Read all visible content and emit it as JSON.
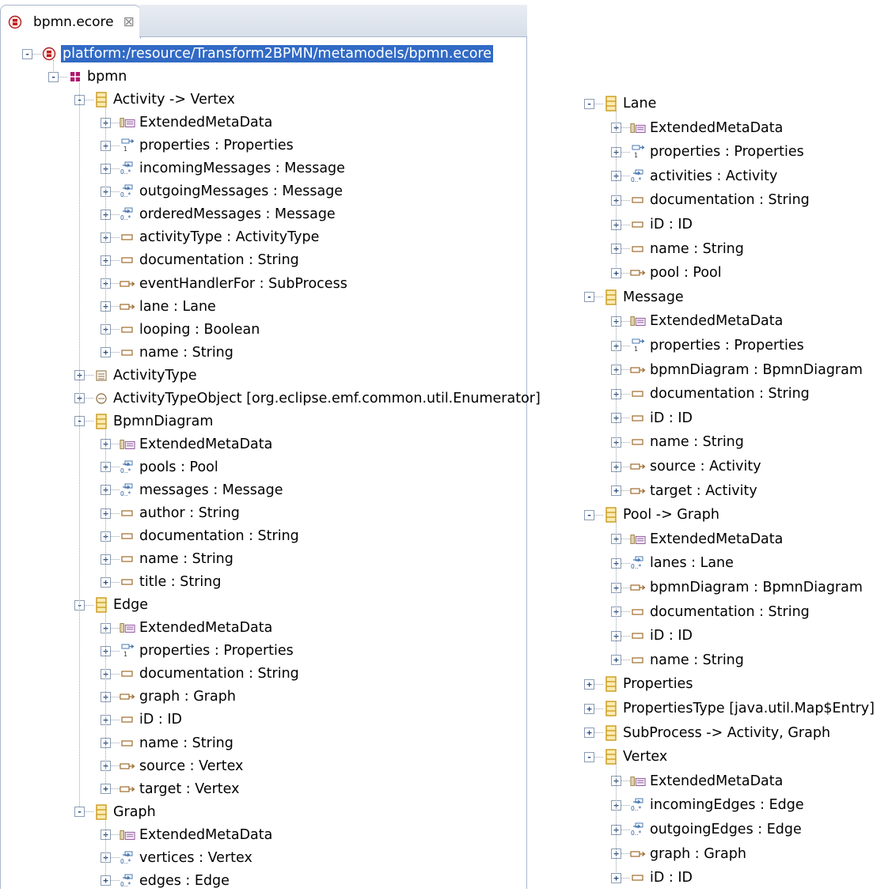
{
  "tab": {
    "title": "bpmn.ecore",
    "close_glyph": "⊠"
  },
  "colors": {
    "selection": "#316ac5",
    "class_icon": "#e8b840",
    "tree_lines": "#9aa4b0"
  },
  "left_tree": [
    {
      "label": "platform:/resource/Transform2BPMN/metamodels/bpmn.ecore",
      "icon": "resource-icon",
      "toggle": "-",
      "level": 0,
      "selected": true
    },
    {
      "label": "bpmn",
      "icon": "package-icon",
      "toggle": "-",
      "level": 1
    },
    {
      "label": "Activity -> Vertex",
      "icon": "eclass-icon",
      "toggle": "-",
      "level": 2
    },
    {
      "label": "ExtendedMetaData",
      "icon": "annotation-icon",
      "toggle": "+",
      "level": 3
    },
    {
      "label": "properties : Properties",
      "icon": "containment-one-icon",
      "toggle": "+",
      "level": 3
    },
    {
      "label": "incomingMessages : Message",
      "icon": "containment-many-icon",
      "toggle": "+",
      "level": 3
    },
    {
      "label": "outgoingMessages : Message",
      "icon": "containment-many-icon",
      "toggle": "+",
      "level": 3
    },
    {
      "label": "orderedMessages : Message",
      "icon": "containment-many-icon",
      "toggle": "+",
      "level": 3
    },
    {
      "label": "activityType : ActivityType",
      "icon": "attribute-icon",
      "toggle": "+",
      "level": 3
    },
    {
      "label": "documentation : String",
      "icon": "attribute-icon",
      "toggle": "+",
      "level": 3
    },
    {
      "label": "eventHandlerFor : SubProcess",
      "icon": "reference-icon",
      "toggle": "+",
      "level": 3
    },
    {
      "label": "lane : Lane",
      "icon": "reference-icon",
      "toggle": "+",
      "level": 3
    },
    {
      "label": "looping : Boolean",
      "icon": "attribute-icon",
      "toggle": "+",
      "level": 3
    },
    {
      "label": "name : String",
      "icon": "attribute-icon",
      "toggle": "+",
      "level": 3
    },
    {
      "label": "ActivityType",
      "icon": "enum-icon",
      "toggle": "+",
      "level": 2
    },
    {
      "label": "ActivityTypeObject [org.eclipse.emf.common.util.Enumerator]",
      "icon": "datatype-icon",
      "toggle": "+",
      "level": 2
    },
    {
      "label": "BpmnDiagram",
      "icon": "eclass-icon",
      "toggle": "-",
      "level": 2
    },
    {
      "label": "ExtendedMetaData",
      "icon": "annotation-icon",
      "toggle": "+",
      "level": 3
    },
    {
      "label": "pools : Pool",
      "icon": "containment-many-icon",
      "toggle": "+",
      "level": 3
    },
    {
      "label": "messages : Message",
      "icon": "containment-many-icon",
      "toggle": "+",
      "level": 3
    },
    {
      "label": "author : String",
      "icon": "attribute-icon",
      "toggle": "+",
      "level": 3
    },
    {
      "label": "documentation : String",
      "icon": "attribute-icon",
      "toggle": "+",
      "level": 3
    },
    {
      "label": "name : String",
      "icon": "attribute-icon",
      "toggle": "+",
      "level": 3
    },
    {
      "label": "title : String",
      "icon": "attribute-icon",
      "toggle": "+",
      "level": 3
    },
    {
      "label": "Edge",
      "icon": "eclass-icon",
      "toggle": "-",
      "level": 2
    },
    {
      "label": "ExtendedMetaData",
      "icon": "annotation-icon",
      "toggle": "+",
      "level": 3
    },
    {
      "label": "properties : Properties",
      "icon": "containment-one-icon",
      "toggle": "+",
      "level": 3
    },
    {
      "label": "documentation : String",
      "icon": "attribute-icon",
      "toggle": "+",
      "level": 3
    },
    {
      "label": "graph : Graph",
      "icon": "reference-icon",
      "toggle": "+",
      "level": 3
    },
    {
      "label": "iD : ID",
      "icon": "attribute-icon",
      "toggle": "+",
      "level": 3
    },
    {
      "label": "name : String",
      "icon": "attribute-icon",
      "toggle": "+",
      "level": 3
    },
    {
      "label": "source : Vertex",
      "icon": "reference-icon",
      "toggle": "+",
      "level": 3
    },
    {
      "label": "target : Vertex",
      "icon": "reference-icon",
      "toggle": "+",
      "level": 3
    },
    {
      "label": "Graph",
      "icon": "eclass-icon",
      "toggle": "-",
      "level": 2
    },
    {
      "label": "ExtendedMetaData",
      "icon": "annotation-icon",
      "toggle": "+",
      "level": 3
    },
    {
      "label": "vertices : Vertex",
      "icon": "containment-many-icon",
      "toggle": "+",
      "level": 3
    },
    {
      "label": "edges : Edge",
      "icon": "containment-many-icon",
      "toggle": "+",
      "level": 3
    }
  ],
  "right_tree": [
    {
      "label": "Lane",
      "icon": "eclass-icon",
      "toggle": "-",
      "level": 0
    },
    {
      "label": "ExtendedMetaData",
      "icon": "annotation-icon",
      "toggle": "+",
      "level": 1
    },
    {
      "label": "properties : Properties",
      "icon": "containment-one-icon",
      "toggle": "+",
      "level": 1
    },
    {
      "label": "activities : Activity",
      "icon": "containment-many-icon",
      "toggle": "+",
      "level": 1
    },
    {
      "label": "documentation : String",
      "icon": "attribute-icon",
      "toggle": "+",
      "level": 1
    },
    {
      "label": "iD : ID",
      "icon": "attribute-icon",
      "toggle": "+",
      "level": 1
    },
    {
      "label": "name : String",
      "icon": "attribute-icon",
      "toggle": "+",
      "level": 1
    },
    {
      "label": "pool : Pool",
      "icon": "reference-icon",
      "toggle": "+",
      "level": 1
    },
    {
      "label": "Message",
      "icon": "eclass-icon",
      "toggle": "-",
      "level": 0
    },
    {
      "label": "ExtendedMetaData",
      "icon": "annotation-icon",
      "toggle": "+",
      "level": 1
    },
    {
      "label": "properties : Properties",
      "icon": "containment-one-icon",
      "toggle": "+",
      "level": 1
    },
    {
      "label": "bpmnDiagram : BpmnDiagram",
      "icon": "reference-icon",
      "toggle": "+",
      "level": 1
    },
    {
      "label": "documentation : String",
      "icon": "attribute-icon",
      "toggle": "+",
      "level": 1
    },
    {
      "label": "iD : ID",
      "icon": "attribute-icon",
      "toggle": "+",
      "level": 1
    },
    {
      "label": "name : String",
      "icon": "attribute-icon",
      "toggle": "+",
      "level": 1
    },
    {
      "label": "source : Activity",
      "icon": "reference-icon",
      "toggle": "+",
      "level": 1
    },
    {
      "label": "target : Activity",
      "icon": "reference-icon",
      "toggle": "+",
      "level": 1
    },
    {
      "label": "Pool -> Graph",
      "icon": "eclass-icon",
      "toggle": "-",
      "level": 0
    },
    {
      "label": "ExtendedMetaData",
      "icon": "annotation-icon",
      "toggle": "+",
      "level": 1
    },
    {
      "label": "lanes : Lane",
      "icon": "containment-many-icon",
      "toggle": "+",
      "level": 1
    },
    {
      "label": "bpmnDiagram : BpmnDiagram",
      "icon": "reference-icon",
      "toggle": "+",
      "level": 1
    },
    {
      "label": "documentation : String",
      "icon": "attribute-icon",
      "toggle": "+",
      "level": 1
    },
    {
      "label": "iD : ID",
      "icon": "attribute-icon",
      "toggle": "+",
      "level": 1
    },
    {
      "label": "name : String",
      "icon": "attribute-icon",
      "toggle": "+",
      "level": 1
    },
    {
      "label": "Properties",
      "icon": "eclass-icon",
      "toggle": "+",
      "level": 0
    },
    {
      "label": "PropertiesType [java.util.Map$Entry]",
      "icon": "eclass-icon",
      "toggle": "+",
      "level": 0
    },
    {
      "label": "SubProcess -> Activity, Graph",
      "icon": "eclass-icon",
      "toggle": "+",
      "level": 0
    },
    {
      "label": "Vertex",
      "icon": "eclass-icon",
      "toggle": "-",
      "level": 0
    },
    {
      "label": "ExtendedMetaData",
      "icon": "annotation-icon",
      "toggle": "+",
      "level": 1
    },
    {
      "label": "incomingEdges : Edge",
      "icon": "containment-many-icon",
      "toggle": "+",
      "level": 1
    },
    {
      "label": "outgoingEdges : Edge",
      "icon": "containment-many-icon",
      "toggle": "+",
      "level": 1
    },
    {
      "label": "graph : Graph",
      "icon": "reference-icon",
      "toggle": "+",
      "level": 1
    },
    {
      "label": "iD : ID",
      "icon": "attribute-icon",
      "toggle": "+",
      "level": 1
    }
  ]
}
